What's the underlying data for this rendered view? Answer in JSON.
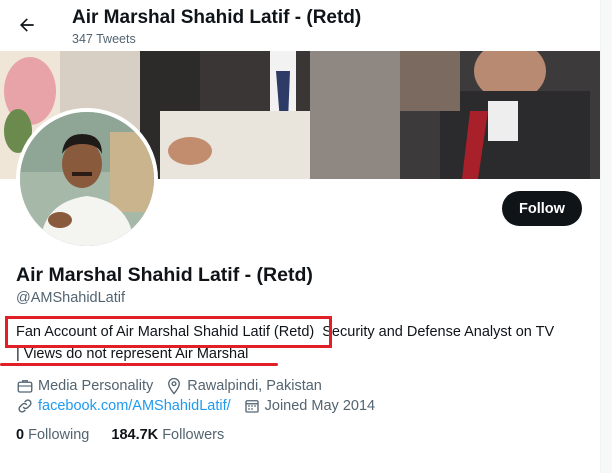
{
  "header": {
    "title": "Air Marshal Shahid Latif - (Retd)",
    "tweet_count": "347 Tweets"
  },
  "profile": {
    "name": "Air Marshal Shahid Latif - (Retd)",
    "handle": "@AMShahidLatif",
    "follow_label": "Follow",
    "bio_line1": "Fan Account of Air Marshal Shahid Latif (Retd)  Security and Defense Analyst on TV",
    "bio_line2": "| Views do not represent Air Marshal",
    "category": "Media Personality",
    "location": "Rawalpindi, Pakistan",
    "website": "facebook.com/AMShahidLatif/",
    "joined": "Joined May 2014",
    "following_count": "0",
    "following_label": "Following",
    "followers_count": "184.7K",
    "followers_label": "Followers"
  },
  "icons": [
    "back-arrow-icon",
    "briefcase-icon",
    "location-pin-icon",
    "link-icon",
    "calendar-icon"
  ],
  "colors": {
    "highlight": "#e11f26",
    "link": "#1d9bf0",
    "follow_button": "#0f1419",
    "secondary_text": "#536471"
  }
}
